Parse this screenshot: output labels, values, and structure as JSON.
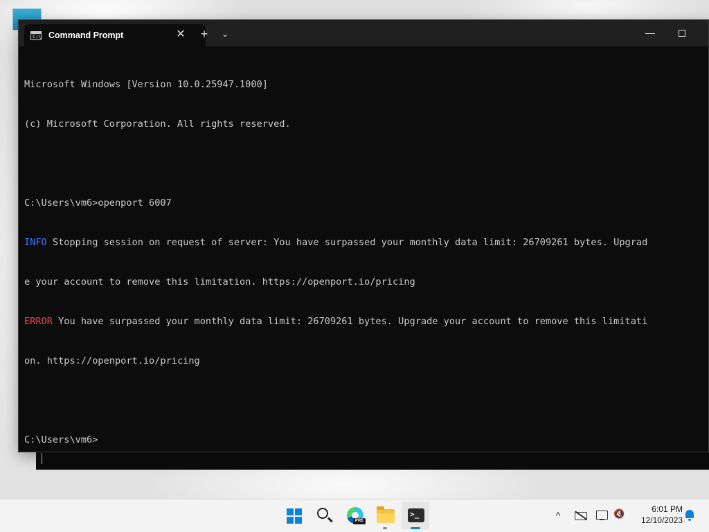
{
  "window": {
    "tab_title": "Command Prompt",
    "tab_icon_text": "C:\\",
    "close_glyph": "✕",
    "new_tab_glyph": "+",
    "dropdown_glyph": "⌄",
    "minimize_glyph": "—"
  },
  "console": {
    "lines": [
      {
        "text": "Microsoft Windows [Version 10.0.25947.1000]"
      },
      {
        "text": "(c) Microsoft Corporation. All rights reserved."
      },
      {
        "text": ""
      },
      {
        "text": "C:\\Users\\vm6>openport 6007"
      },
      {
        "tag": "INFO",
        "text": " Stopping session on request of server: You have surpassed your monthly data limit: 26709261 bytes. Upgrad"
      },
      {
        "text": "e your account to remove this limitation. https://openport.io/pricing"
      },
      {
        "tag": "ERROR",
        "text": " You have surpassed your monthly data limit: 26709261 bytes. Upgrade your account to remove this limitati"
      },
      {
        "text": "on. https://openport.io/pricing"
      },
      {
        "text": ""
      },
      {
        "text": "C:\\Users\\vm6>"
      }
    ]
  },
  "taskbar": {
    "apps": [
      {
        "name": "start",
        "icon": "windows-logo-icon"
      },
      {
        "name": "search",
        "icon": "search-icon"
      },
      {
        "name": "edge-preview",
        "icon": "edge-icon",
        "badge": "PRE"
      },
      {
        "name": "file-explorer",
        "icon": "folder-icon"
      },
      {
        "name": "terminal",
        "icon": "terminal-icon",
        "glyph": ">_"
      }
    ],
    "tray_chevron": "^",
    "volume_glyph": "🔇",
    "time": "6:01 PM",
    "date": "12/10/2023"
  },
  "colors": {
    "console_bg": "#0c0c0c",
    "console_fg": "#cccccc",
    "info": "#3b78ff",
    "error": "#e74856",
    "accent": "#0a84d8"
  }
}
